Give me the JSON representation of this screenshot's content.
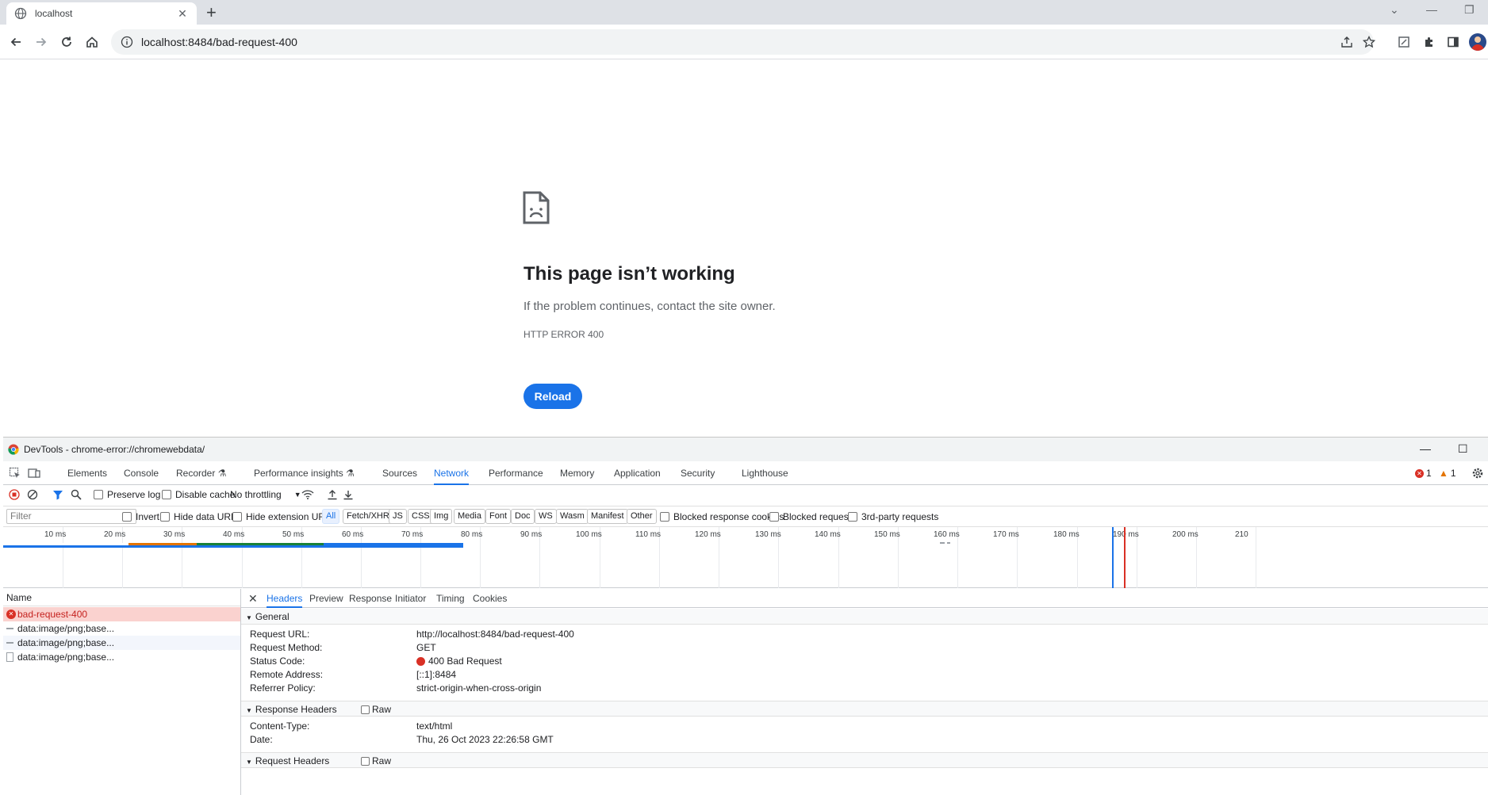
{
  "browser": {
    "tab_title": "localhost",
    "address": "localhost:8484/bad-request-400"
  },
  "error_page": {
    "title": "This page isn’t working",
    "description": "If the problem continues, contact the site owner.",
    "code": "HTTP ERROR 400",
    "reload_label": "Reload"
  },
  "devtools": {
    "title": "DevTools - chrome-error://chromewebdata/",
    "tabs": [
      "Elements",
      "Console",
      "Recorder",
      "Performance insights",
      "Sources",
      "Network",
      "Performance",
      "Memory",
      "Application",
      "Security",
      "Lighthouse"
    ],
    "active_tab": "Network",
    "errors": "1",
    "warnings": "1",
    "toolbar": {
      "preserve_log": "Preserve log",
      "disable_cache": "Disable cache",
      "throttling": "No throttling"
    },
    "filter": {
      "placeholder": "Filter",
      "invert": "Invert",
      "hide_data_urls": "Hide data URLs",
      "hide_extension_urls": "Hide extension URLs",
      "types": [
        "All",
        "Fetch/XHR",
        "JS",
        "CSS",
        "Img",
        "Media",
        "Font",
        "Doc",
        "WS",
        "Wasm",
        "Manifest",
        "Other"
      ],
      "blocked_response_cookies": "Blocked response cookies",
      "blocked_requests": "Blocked requests",
      "third_party": "3rd-party requests"
    },
    "timeline_ticks": [
      "10 ms",
      "20 ms",
      "30 ms",
      "40 ms",
      "50 ms",
      "60 ms",
      "70 ms",
      "80 ms",
      "90 ms",
      "100 ms",
      "110 ms",
      "120 ms",
      "130 ms",
      "140 ms",
      "150 ms",
      "160 ms",
      "170 ms",
      "180 ms",
      "190 ms",
      "200 ms",
      "210"
    ],
    "requests": {
      "header": "Name",
      "rows": [
        "bad-request-400",
        "data:image/png;base...",
        "data:image/png;base...",
        "data:image/png;base..."
      ]
    },
    "detail": {
      "tabs": [
        "Headers",
        "Preview",
        "Response",
        "Initiator",
        "Timing",
        "Cookies"
      ],
      "general_title": "General",
      "general": [
        {
          "key": "Request URL:",
          "value": "http://localhost:8484/bad-request-400"
        },
        {
          "key": "Request Method:",
          "value": "GET"
        },
        {
          "key": "Status Code:",
          "value": "400 Bad Request"
        },
        {
          "key": "Remote Address:",
          "value": "[::1]:8484"
        },
        {
          "key": "Referrer Policy:",
          "value": "strict-origin-when-cross-origin"
        }
      ],
      "response_headers_title": "Response Headers",
      "raw_label": "Raw",
      "response_headers": [
        {
          "key": "Content-Type:",
          "value": "text/html"
        },
        {
          "key": "Date:",
          "value": "Thu, 26 Oct 2023 22:26:58 GMT"
        }
      ],
      "request_headers_title": "Request Headers"
    }
  },
  "colors": {
    "accent": "#1a73e8",
    "error": "#d93025",
    "error_row_bg": "#fad2cf"
  }
}
